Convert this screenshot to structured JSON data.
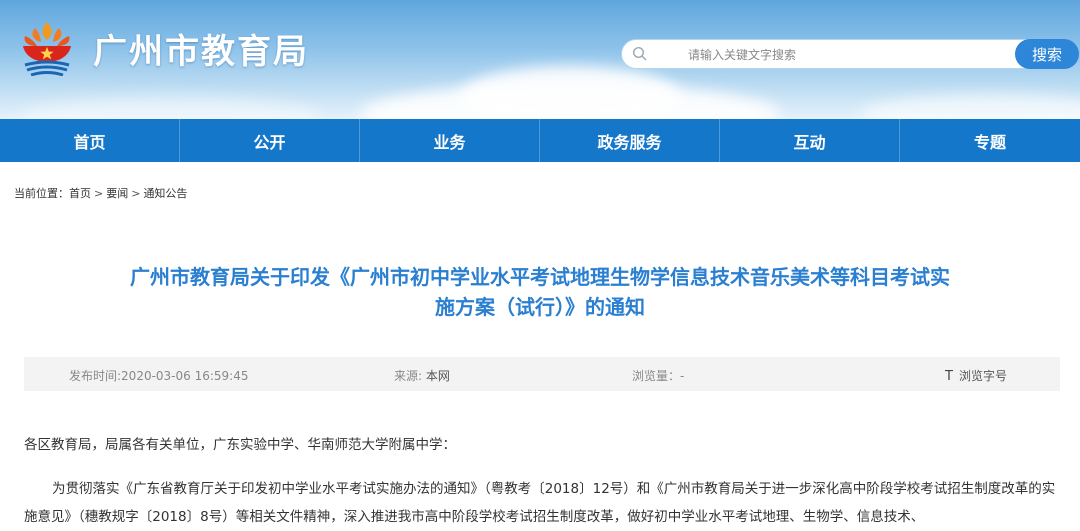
{
  "header": {
    "site_name": "广州市教育局",
    "search_placeholder": "请输入关键文字搜索",
    "search_button": "搜索"
  },
  "nav": {
    "items": [
      {
        "label": "首页"
      },
      {
        "label": "公开"
      },
      {
        "label": "业务"
      },
      {
        "label": "政务服务"
      },
      {
        "label": "互动"
      },
      {
        "label": "专题"
      }
    ]
  },
  "breadcrumb": {
    "prefix": "当前位置：",
    "items": [
      "首页",
      "要闻",
      "通知公告"
    ],
    "separator": ">"
  },
  "article": {
    "title_line1": "广州市教育局关于印发《广州市初中学业水平考试地理生物学信息技术音乐美术等科目考试实",
    "title_line2": "施方案（试行）》的通知",
    "meta": {
      "publish_label": "发布时间:",
      "publish_time": "2020-03-06 16:59:45",
      "source_label": "来源: ",
      "source": "本网",
      "views_label": "浏览量：",
      "views": "-",
      "font_icon": "T",
      "font_label": "浏览字号"
    },
    "greeting": "各区教育局，局属各有关单位，广东实验中学、华南师范大学附属中学：",
    "body": "为贯彻落实《广东省教育厅关于印发初中学业水平考试实施办法的通知》（粤教考〔2018〕12号）和《广州市教育局关于进一步深化高中阶段学校考试招生制度改革的实施意见》（穗教规字〔2018〕8号）等相关文件精神，深入推进我市高中阶段学校考试招生制度改革，做好初中学业水平考试地理、生物学、信息技术、"
  },
  "colors": {
    "nav_bg": "#1577c9",
    "title": "#2a7fd0",
    "search_button": "#2e86d8"
  }
}
